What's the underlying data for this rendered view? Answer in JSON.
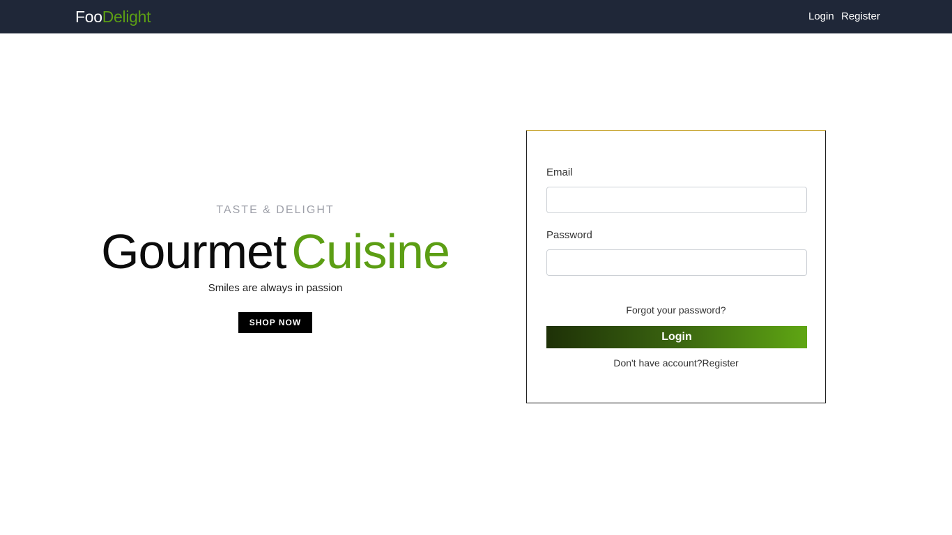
{
  "navbar": {
    "brand_part1": "Foo",
    "brand_part2": "Delight",
    "login_label": "Login",
    "register_label": "Register"
  },
  "hero": {
    "eyebrow": "TASTE & DELIGHT",
    "headline_word1": "Gourmet",
    "headline_word2": "Cuisine",
    "tagline": "Smiles are always in passion",
    "shop_button": "SHOP NOW"
  },
  "login_form": {
    "email_label": "Email",
    "email_value": "",
    "password_label": "Password",
    "password_value": "",
    "forgot_link": "Forgot your password?",
    "submit_label": "Login",
    "no_account_text": "Don't have account?",
    "register_link": "Register"
  },
  "colors": {
    "navbar_bg": "#1f2738",
    "accent_green": "#5c9e14",
    "card_top_border": "#c7a42e"
  }
}
